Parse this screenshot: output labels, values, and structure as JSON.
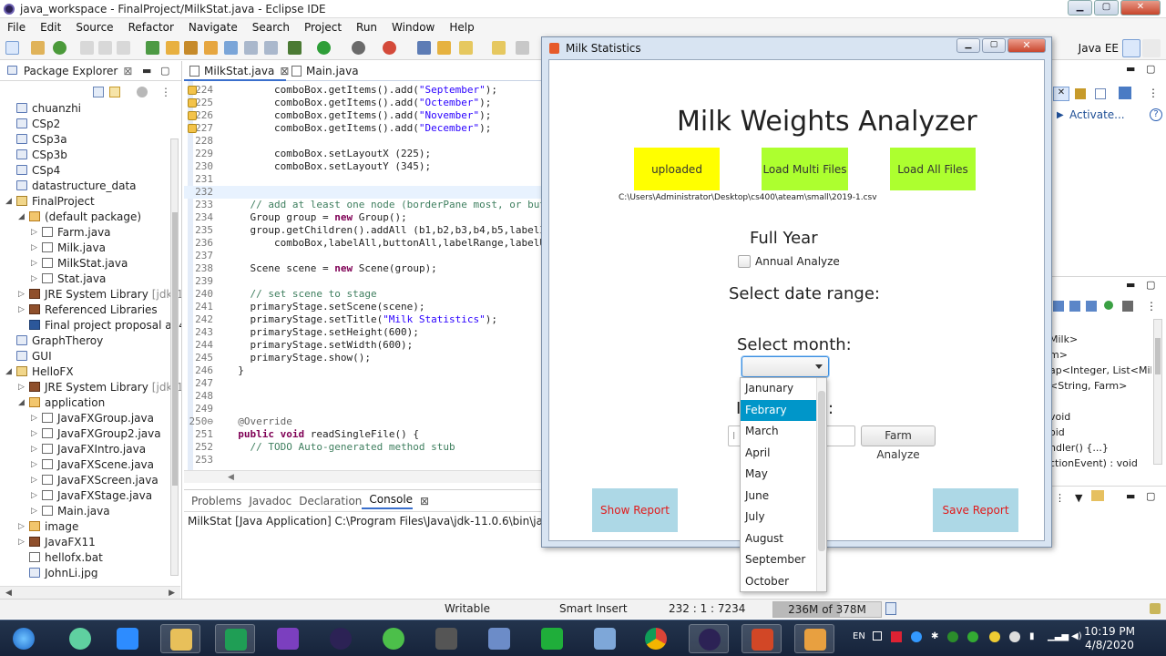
{
  "window": {
    "title": "java_workspace - FinalProject/MilkStat.java - Eclipse IDE"
  },
  "menu": [
    "File",
    "Edit",
    "Source",
    "Refactor",
    "Navigate",
    "Search",
    "Project",
    "Run",
    "Window",
    "Help"
  ],
  "toolbar": {
    "perspective": "Java EE"
  },
  "package_explorer": {
    "tab": "Package Explorer",
    "items": [
      {
        "label": "chuanzhi",
        "indent": 0,
        "icon": "folder-icon"
      },
      {
        "label": "CSp2",
        "indent": 0,
        "icon": "folder-icon"
      },
      {
        "label": "CSp3a",
        "indent": 0,
        "icon": "folder-icon"
      },
      {
        "label": "CSp3b",
        "indent": 0,
        "icon": "folder-icon"
      },
      {
        "label": "CSp4",
        "indent": 0,
        "icon": "folder-icon"
      },
      {
        "label": "datastructure_data",
        "indent": 0,
        "icon": "folder-icon"
      },
      {
        "label": "FinalProject",
        "indent": 0,
        "icon": "project-icon",
        "arrow": "◢"
      },
      {
        "label": "(default package)",
        "indent": 1,
        "icon": "package-icon",
        "arrow": "◢"
      },
      {
        "label": "Farm.java",
        "indent": 2,
        "icon": "java-file-icon",
        "arrow": "▷"
      },
      {
        "label": "Milk.java",
        "indent": 2,
        "icon": "java-file-icon",
        "arrow": "▷"
      },
      {
        "label": "MilkStat.java",
        "indent": 2,
        "icon": "java-file-icon",
        "arrow": "▷"
      },
      {
        "label": "Stat.java",
        "indent": 2,
        "icon": "java-file-icon",
        "arrow": "▷"
      },
      {
        "label": "JRE System Library",
        "suffix": "[jdk-1:",
        "indent": 1,
        "icon": "library-icon",
        "arrow": "▷"
      },
      {
        "label": "Referenced Libraries",
        "indent": 1,
        "icon": "library-icon",
        "arrow": "▷"
      },
      {
        "label": "Final project proposal a14",
        "indent": 1,
        "icon": "word-doc-icon"
      },
      {
        "label": "GraphTheroy",
        "indent": 0,
        "icon": "folder-icon"
      },
      {
        "label": "GUI",
        "indent": 0,
        "icon": "folder-icon"
      },
      {
        "label": "HelloFX",
        "indent": 0,
        "icon": "project-icon",
        "arrow": "◢"
      },
      {
        "label": "JRE System Library",
        "suffix": "[jdk-1:",
        "indent": 1,
        "icon": "library-icon",
        "arrow": "▷"
      },
      {
        "label": "application",
        "indent": 1,
        "icon": "package-icon",
        "arrow": "◢"
      },
      {
        "label": "JavaFXGroup.java",
        "indent": 2,
        "icon": "java-file-icon",
        "arrow": "▷"
      },
      {
        "label": "JavaFXGroup2.java",
        "indent": 2,
        "icon": "java-file-icon",
        "arrow": "▷"
      },
      {
        "label": "JavaFXIntro.java",
        "indent": 2,
        "icon": "java-file-icon",
        "arrow": "▷"
      },
      {
        "label": "JavaFXScene.java",
        "indent": 2,
        "icon": "java-file-icon",
        "arrow": "▷"
      },
      {
        "label": "JavaFXScreen.java",
        "indent": 2,
        "icon": "java-file-icon",
        "arrow": "▷"
      },
      {
        "label": "JavaFXStage.java",
        "indent": 2,
        "icon": "java-file-icon",
        "arrow": "▷"
      },
      {
        "label": "Main.java",
        "indent": 2,
        "icon": "java-file-icon",
        "arrow": "▷"
      },
      {
        "label": "image",
        "indent": 1,
        "icon": "package-icon",
        "arrow": "▷"
      },
      {
        "label": "JavaFX11",
        "indent": 1,
        "icon": "library-icon",
        "arrow": "▷"
      },
      {
        "label": "hellofx.bat",
        "indent": 1,
        "icon": "bat-file-icon"
      },
      {
        "label": "JohnLi.jpg",
        "indent": 1,
        "icon": "image-file-icon"
      }
    ]
  },
  "editor": {
    "tabs": [
      "MilkStat.java",
      "Main.java"
    ],
    "lines": [
      {
        "n": "224",
        "html": "        comboBox.getItems().add(<s>\"September\"</s>);",
        "warn": true
      },
      {
        "n": "225",
        "html": "        comboBox.getItems().add(<s>\"Octember\"</s>);",
        "warn": true
      },
      {
        "n": "226",
        "html": "        comboBox.getItems().add(<s>\"November\"</s>);",
        "warn": true
      },
      {
        "n": "227",
        "html": "        comboBox.getItems().add(<s>\"December\"</s>);",
        "warn": true
      },
      {
        "n": "228",
        "html": ""
      },
      {
        "n": "229",
        "html": "        comboBox.setLayoutX (225);"
      },
      {
        "n": "230",
        "html": "        comboBox.setLayoutY (345);"
      },
      {
        "n": "231",
        "html": ""
      },
      {
        "n": "232",
        "html": "",
        "hl": true
      },
      {
        "n": "233",
        "html": "    <c>// add at least one node (borderPane most, or but</c>"
      },
      {
        "n": "234",
        "html": "    Group group = <k>new</k> Group();"
      },
      {
        "n": "235",
        "html": "    group.getChildren().addAll (b1,b2,b3,b4,b5,labelI"
      },
      {
        "n": "236",
        "html": "        comboBox,labelAll,buttonAll,labelRange,labelU"
      },
      {
        "n": "237",
        "html": ""
      },
      {
        "n": "238",
        "html": "    Scene scene = <k>new</k> Scene(group);"
      },
      {
        "n": "239",
        "html": ""
      },
      {
        "n": "240",
        "html": "    <c>// set scene to stage</c>"
      },
      {
        "n": "241",
        "html": "    primaryStage.setScene(scene);"
      },
      {
        "n": "242",
        "html": "    primaryStage.setTitle(<s>\"Milk Statistics\"</s>);"
      },
      {
        "n": "243",
        "html": "    primaryStage.setHeight(600);"
      },
      {
        "n": "244",
        "html": "    primaryStage.setWidth(600);"
      },
      {
        "n": "245",
        "html": "    primaryStage.show();"
      },
      {
        "n": "246",
        "html": "  }"
      },
      {
        "n": "247",
        "html": ""
      },
      {
        "n": "248",
        "html": ""
      },
      {
        "n": "249",
        "html": ""
      },
      {
        "n": "250⊖",
        "html": "  <a>@Override</a>"
      },
      {
        "n": "251",
        "html": "  <k>public</k> <k>void</k> readSingleFile() {"
      },
      {
        "n": "252",
        "html": "    <c>// TODO Auto-generated method stub</c>"
      },
      {
        "n": "253",
        "html": ""
      }
    ]
  },
  "console": {
    "tabs": [
      "Problems",
      "Javadoc",
      "Declaration",
      "Console"
    ],
    "line": "MilkStat [Java Application] C:\\Program Files\\Java\\jdk-11.0.6\\bin\\javaw.exe (Ap"
  },
  "right_panel": {
    "activate": "Activate...",
    "outline": [
      "Milk>",
      "m>",
      "ap<Integer, List<Milk",
      "<String, Farm>",
      "",
      "void",
      "oid",
      "ndler() {...}",
      "ctionEvent) : void"
    ]
  },
  "status": {
    "writable": "Writable",
    "insert": "Smart Insert",
    "position": "232 : 1 : 7234",
    "heap": "236M of 378M",
    "heap_used_fraction": 0.62
  },
  "dialog": {
    "title": "Milk Statistics",
    "heading": "Milk Weights Analyzer",
    "btn_uploaded": "uploaded",
    "btn_multi": "Load Multi Files",
    "btn_all": "Load All Files",
    "file_path": "C:\\Users\\Administrator\\Desktop\\cs400\\ateam\\small\\2019-1.csv",
    "full_year": "Full Year",
    "annual": "Annual Analyze",
    "date_range": "Select date range:",
    "select_month": "Select month:",
    "hidden_label_start": "I",
    "hidden_label_end": ":",
    "field_placeholder_start": "I",
    "farm_analyze": "Farm Analyze",
    "show_report": "Show Report",
    "save_report": "Save Report",
    "colors": {
      "yellow": "#ffff00",
      "lime": "#adff2f",
      "lightblue": "#add8e6",
      "report_text": "#e11a1a"
    }
  },
  "month_dropdown": {
    "options": [
      "Janunary",
      "Febrary",
      "March",
      "April",
      "May",
      "June",
      "July",
      "August",
      "September",
      "October"
    ],
    "selected_index": 1
  },
  "taskbar": {
    "time": "10:19 PM",
    "date": "4/8/2020",
    "lang": "EN"
  }
}
